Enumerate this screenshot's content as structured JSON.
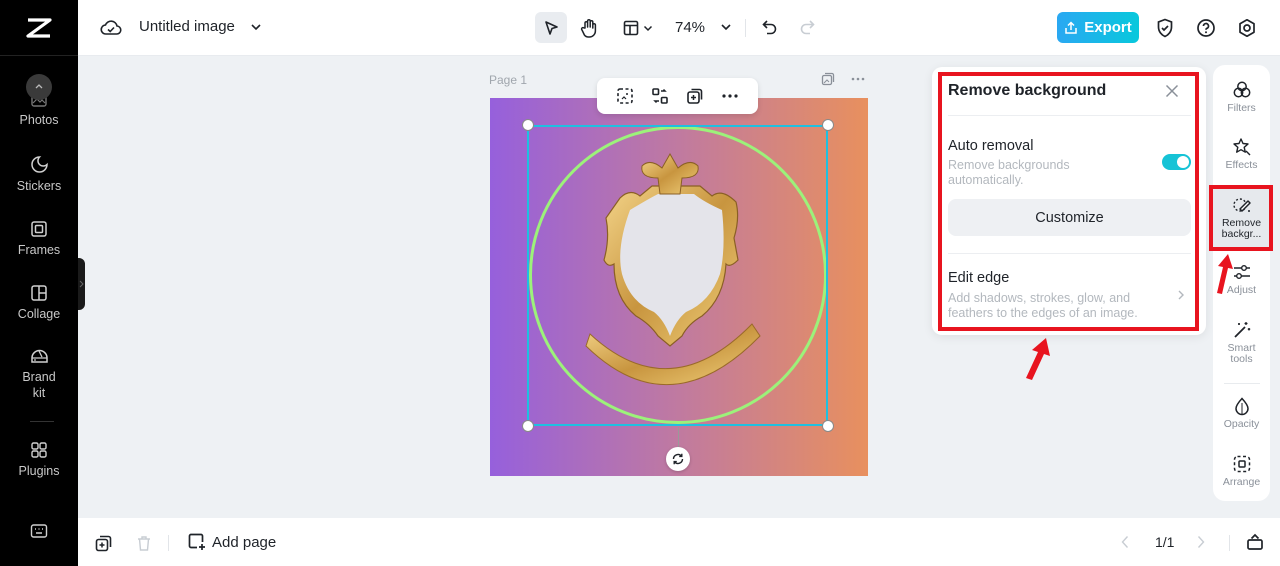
{
  "app": {
    "logo": "capcut-logo"
  },
  "topbar": {
    "title": "Untitled image",
    "zoom": "74%",
    "export_label": "Export"
  },
  "sidebar": {
    "items": [
      {
        "label": "Photos",
        "icon": "photo-icon"
      },
      {
        "label": "Stickers",
        "icon": "sticker-icon"
      },
      {
        "label": "Frames",
        "icon": "frame-icon"
      },
      {
        "label": "Collage",
        "icon": "collage-icon"
      },
      {
        "label": "Brand kit",
        "icon": "brand-kit-icon"
      },
      {
        "label": "Plugins",
        "icon": "plugins-icon"
      }
    ]
  },
  "canvas": {
    "page_label": "Page 1",
    "background_gradient": [
      "#9660dc",
      "#e8905e"
    ],
    "selection_color": "#1fc0e0"
  },
  "panel": {
    "title": "Remove background",
    "auto_removal": {
      "title": "Auto removal",
      "description": "Remove backgrounds automatically.",
      "enabled": true
    },
    "customize_label": "Customize",
    "edit_edge": {
      "title": "Edit edge",
      "description": "Add shadows, strokes, glow, and feathers to the edges of an image."
    }
  },
  "rail": {
    "items": [
      {
        "label": "Filters",
        "icon": "filters-icon"
      },
      {
        "label": "Effects",
        "icon": "effects-icon"
      },
      {
        "label": "Remove backgr...",
        "icon": "remove-background-icon",
        "active": true
      },
      {
        "label": "Adjust",
        "icon": "adjust-icon"
      },
      {
        "label": "Smart tools",
        "icon": "smart-tools-icon"
      },
      {
        "label": "Opacity",
        "icon": "opacity-icon"
      },
      {
        "label": "Arrange",
        "icon": "arrange-icon"
      }
    ]
  },
  "bottombar": {
    "add_page_label": "Add page",
    "page_count": "1/1"
  },
  "annotation_color": "#e8141f"
}
